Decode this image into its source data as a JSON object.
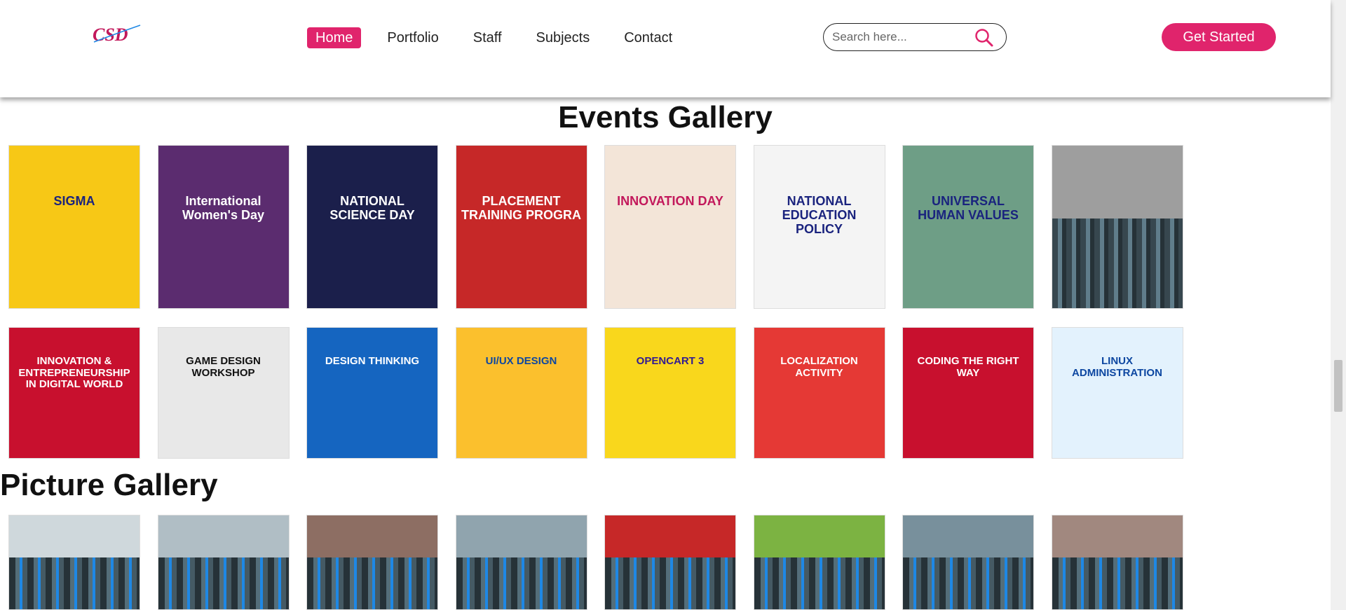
{
  "header": {
    "logo_text": "CSD",
    "nav": [
      "Home",
      "Portfolio",
      "Staff",
      "Subjects",
      "Contact"
    ],
    "active_nav": "Home",
    "search_placeholder": "Search here...",
    "cta_label": "Get Started"
  },
  "events_title": "Events Gallery",
  "picture_title": "Picture Gallery",
  "events_row1": [
    {
      "caption": "SIGMA",
      "bg": "#f7c816",
      "fg": "#1a237e"
    },
    {
      "caption": "International Women's Day",
      "bg": "#5b2c6f",
      "fg": "#ffffff"
    },
    {
      "caption": "NATIONAL SCIENCE DAY",
      "bg": "#1b1f4b",
      "fg": "#ffffff"
    },
    {
      "caption": "PLACEMENT TRAINING PROGRA",
      "bg": "#c62828",
      "fg": "#ffffff"
    },
    {
      "caption": "INNOVATION DAY",
      "bg": "#f3e5d8",
      "fg": "#c2185b"
    },
    {
      "caption": "NATIONAL EDUCATION POLICY",
      "bg": "#f4f4f4",
      "fg": "#1a237e"
    },
    {
      "caption": "UNIVERSAL HUMAN VALUES",
      "bg": "#6e9e86",
      "fg": "#1a237e"
    },
    {
      "caption": "",
      "bg": "#9e9e9e",
      "fg": "#ffffff"
    }
  ],
  "events_row2": [
    {
      "caption": "INNOVATION & ENTREPRENEURSHIP IN DIGITAL WORLD",
      "bg": "#c8102e",
      "fg": "#ffffff"
    },
    {
      "caption": "GAME DESIGN WORKSHOP",
      "bg": "#e8e8e8",
      "fg": "#111111"
    },
    {
      "caption": "DESIGN THINKING",
      "bg": "#1565c0",
      "fg": "#ffffff"
    },
    {
      "caption": "UI/UX DESIGN",
      "bg": "#fbc02d",
      "fg": "#0d47a1"
    },
    {
      "caption": "OPENCART 3",
      "bg": "#f9d71c",
      "fg": "#311b92"
    },
    {
      "caption": "LOCALIZATION ACTIVITY",
      "bg": "#e53935",
      "fg": "#ffffff"
    },
    {
      "caption": "CODING THE RIGHT WAY",
      "bg": "#c8102e",
      "fg": "#ffffff"
    },
    {
      "caption": "LINUX ADMINISTRATION",
      "bg": "#e3f2fd",
      "fg": "#0d47a1"
    }
  ],
  "picture_row": [
    {
      "bg": "#cfd8dc"
    },
    {
      "bg": "#b0bec5"
    },
    {
      "bg": "#8d6e63"
    },
    {
      "bg": "#90a4ae"
    },
    {
      "bg": "#c62828"
    },
    {
      "bg": "#7cb342"
    },
    {
      "bg": "#78909c"
    },
    {
      "bg": "#a1887f"
    }
  ]
}
